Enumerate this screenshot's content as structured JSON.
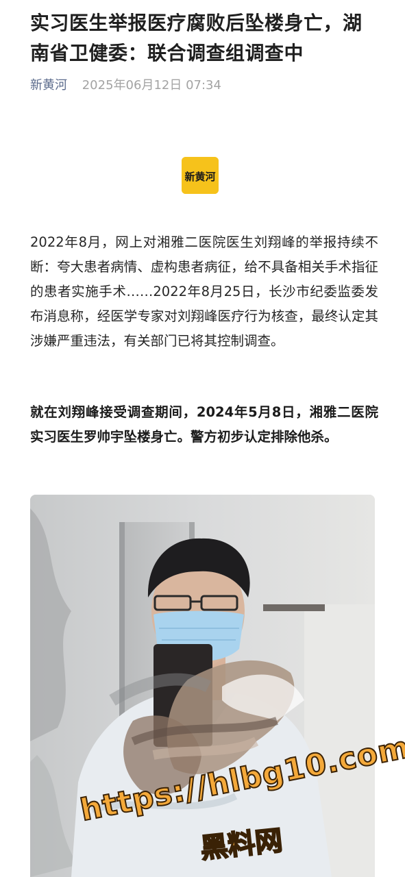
{
  "article": {
    "title": "实习医生举报医疗腐败后坠楼身亡，湖南省卫健委：联合调查组调查中",
    "source": "新黄河",
    "date": "2025年06月12日 07:34",
    "logo_text": "新黄河",
    "paragraphs": [
      "2022年8月，网上对湘雅二医院医生刘翔峰的举报持续不断：夸大患者病情、虚构患者病征，给不具备相关手术指征的患者实施手术……2022年8月25日，长沙市纪委监委发布消息称，经医学专家对刘翔峰医疗行为核查，最终认定其涉嫌严重违法，有关部门已将其控制调查。",
      "就在刘翔峰接受调查期间，2024年5月8日，湘雅二医院实习医生罗帅宇坠楼身亡。警方初步认定排除他杀。"
    ]
  },
  "watermark": {
    "url": "https://hlbg10.com",
    "name": "黑料网"
  },
  "colors": {
    "source": "#5b6b8c",
    "date": "#a3a3a3",
    "logo_bg": "#f6c21b",
    "watermark_fill": "#f4a93a"
  }
}
